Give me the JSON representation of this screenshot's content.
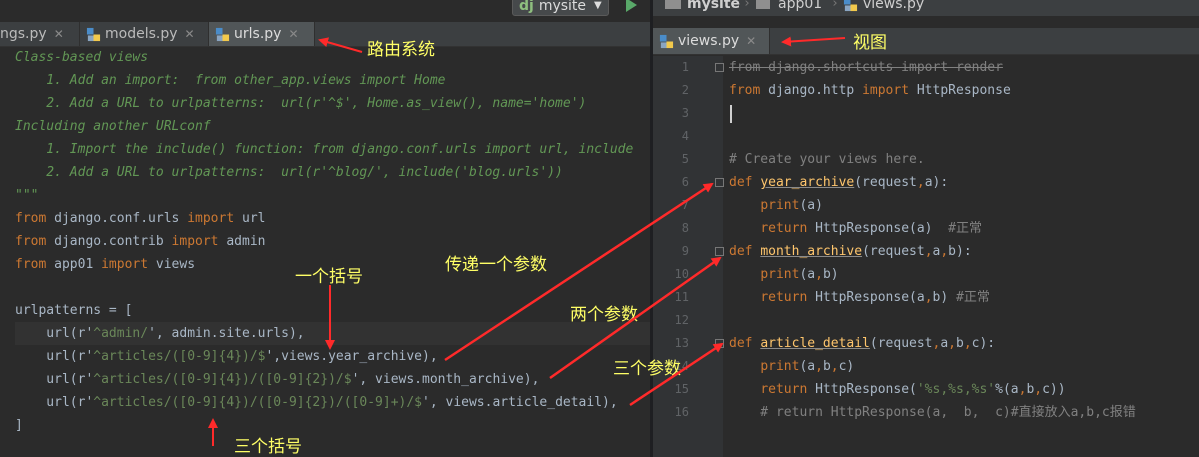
{
  "left": {
    "run_config": "mysite",
    "tabs": [
      {
        "label": "ngs.py",
        "active": false
      },
      {
        "label": "models.py",
        "active": false
      },
      {
        "label": "urls.py",
        "active": true
      }
    ],
    "code": [
      {
        "parts": [
          [
            "cm",
            "Class-based views"
          ]
        ]
      },
      {
        "parts": [
          [
            "cm",
            "    1. Add an import:  from other_app.views import Home"
          ]
        ]
      },
      {
        "parts": [
          [
            "cm",
            "    2. Add a URL to urlpatterns:  url(r'^$', Home.as_view(), name='home')"
          ]
        ]
      },
      {
        "parts": [
          [
            "cm",
            "Including another URLconf"
          ]
        ]
      },
      {
        "parts": [
          [
            "cm",
            "    1. Import the include() function: from django.conf.urls import url, include"
          ]
        ]
      },
      {
        "parts": [
          [
            "cm",
            "    2. Add a URL to urlpatterns:  url(r'^blog/', include('blog.urls'))"
          ]
        ]
      },
      {
        "parts": [
          [
            "cm",
            "\"\"\""
          ]
        ]
      },
      {
        "parts": [
          [
            "kw",
            "from "
          ],
          [
            "",
            "django.conf.urls "
          ],
          [
            "kw",
            "import "
          ],
          [
            "",
            "url"
          ]
        ]
      },
      {
        "parts": [
          [
            "kw",
            "from "
          ],
          [
            "",
            "django.contrib "
          ],
          [
            "kw",
            "import "
          ],
          [
            "",
            "admin"
          ]
        ]
      },
      {
        "parts": [
          [
            "kw",
            "from "
          ],
          [
            "",
            "app01 "
          ],
          [
            "kw",
            "import "
          ],
          [
            "",
            "views"
          ]
        ]
      },
      {
        "parts": [
          [
            "",
            ""
          ]
        ]
      },
      {
        "parts": [
          [
            "",
            "urlpatterns = ["
          ]
        ]
      },
      {
        "parts": [
          [
            "",
            "    url(r'"
          ],
          [
            "str",
            "^admin/"
          ],
          [
            "",
            "', admin.site.urls),"
          ]
        ]
      },
      {
        "parts": [
          [
            "",
            "    url(r'"
          ],
          [
            "str",
            "^articles/([0-9]{4})/$"
          ],
          [
            "",
            "',views.year_archive),"
          ]
        ]
      },
      {
        "parts": [
          [
            "",
            "    url(r'"
          ],
          [
            "str",
            "^articles/([0-9]{4})/([0-9]{2})/$"
          ],
          [
            "",
            "', views.month_archive),"
          ]
        ]
      },
      {
        "parts": [
          [
            "",
            "    url(r'"
          ],
          [
            "str",
            "^articles/([0-9]{4})/([0-9]{2})/([0-9]+)/$"
          ],
          [
            "",
            "', views.article_detail),"
          ]
        ]
      },
      {
        "parts": [
          [
            "",
            "]"
          ]
        ]
      }
    ]
  },
  "right": {
    "breadcrumbs": [
      "mysite",
      "app01",
      "views.py"
    ],
    "tabs": [
      {
        "label": "views.py",
        "active": true
      }
    ],
    "line_numbers": [
      "1",
      "2",
      "3",
      "4",
      "5",
      "6",
      "7",
      "8",
      "9",
      "10",
      "11",
      "12",
      "13",
      "14",
      "15",
      "16"
    ],
    "code": [
      {
        "parts": [
          [
            "strike",
            "from django.shortcuts import render"
          ]
        ]
      },
      {
        "parts": [
          [
            "kw",
            "from "
          ],
          [
            "",
            "django.http "
          ],
          [
            "kw",
            "import "
          ],
          [
            "",
            "HttpResponse"
          ]
        ]
      },
      {
        "parts": [
          [
            "",
            ""
          ]
        ]
      },
      {
        "parts": [
          [
            "",
            ""
          ]
        ]
      },
      {
        "parts": [
          [
            "gcm",
            "# Create your views here."
          ]
        ]
      },
      {
        "parts": [
          [
            "kw",
            "def "
          ],
          [
            "fn",
            "year_archive"
          ],
          [
            "",
            "(request"
          ],
          [
            "kw",
            ","
          ],
          [
            "",
            "a):"
          ]
        ]
      },
      {
        "parts": [
          [
            "",
            "    "
          ],
          [
            "kw",
            "print"
          ],
          [
            "",
            "(a)"
          ]
        ]
      },
      {
        "parts": [
          [
            "",
            "    "
          ],
          [
            "kw",
            "return "
          ],
          [
            "",
            "HttpResponse(a)  "
          ],
          [
            "gcm",
            "#正常"
          ]
        ]
      },
      {
        "parts": [
          [
            "kw",
            "def "
          ],
          [
            "fn",
            "month_archive"
          ],
          [
            "",
            "(request"
          ],
          [
            "kw",
            ","
          ],
          [
            "",
            "a"
          ],
          [
            "kw",
            ","
          ],
          [
            "",
            "b):"
          ]
        ]
      },
      {
        "parts": [
          [
            "",
            "    "
          ],
          [
            "kw",
            "print"
          ],
          [
            "",
            "(a"
          ],
          [
            "kw",
            ","
          ],
          [
            "",
            "b)"
          ]
        ]
      },
      {
        "parts": [
          [
            "",
            "    "
          ],
          [
            "kw",
            "return "
          ],
          [
            "",
            "HttpResponse(a"
          ],
          [
            "kw",
            ","
          ],
          [
            "",
            "b) "
          ],
          [
            "gcm",
            "#正常"
          ]
        ]
      },
      {
        "parts": [
          [
            "",
            ""
          ]
        ]
      },
      {
        "parts": [
          [
            "kw",
            "def "
          ],
          [
            "fn",
            "article_detail"
          ],
          [
            "",
            "(request"
          ],
          [
            "kw",
            ","
          ],
          [
            "",
            "a"
          ],
          [
            "kw",
            ","
          ],
          [
            "",
            "b"
          ],
          [
            "kw",
            ","
          ],
          [
            "",
            "c):"
          ]
        ]
      },
      {
        "parts": [
          [
            "",
            "    "
          ],
          [
            "kw",
            "print"
          ],
          [
            "",
            "(a"
          ],
          [
            "kw",
            ","
          ],
          [
            "",
            "b"
          ],
          [
            "kw",
            ","
          ],
          [
            "",
            "c)"
          ]
        ]
      },
      {
        "parts": [
          [
            "",
            "    "
          ],
          [
            "kw",
            "return "
          ],
          [
            "",
            "HttpResponse("
          ],
          [
            "str",
            "'%s,%s,%s'"
          ],
          [
            "",
            "%(a"
          ],
          [
            "kw",
            ","
          ],
          [
            "",
            "b"
          ],
          [
            "kw",
            ","
          ],
          [
            "",
            "c))"
          ]
        ]
      },
      {
        "parts": [
          [
            "gcm",
            "    # return HttpResponse(a,  b,  c)#直接放入a,b,c报错"
          ]
        ]
      }
    ]
  },
  "annotations": {
    "routing_system": "路由系统",
    "view": "视图",
    "one_paren": "一个括号",
    "pass_one_param": "传递一个参数",
    "two_params": "两个参数",
    "three_params": "三个参数",
    "three_parens": "三个括号"
  },
  "colors": {
    "bg": "#2b2b2b",
    "keyword": "#cc7832",
    "string": "#6a8759",
    "comment": "#629755",
    "function": "#ffc66d",
    "annotation": "#ffff66",
    "arrow": "#ff2a2a"
  }
}
